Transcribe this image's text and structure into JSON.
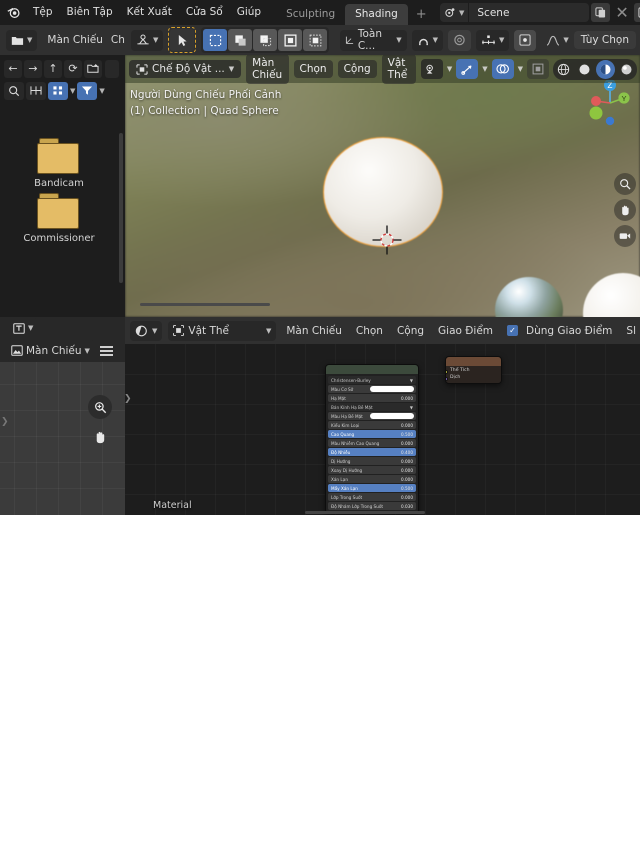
{
  "app": {
    "title": "Blender",
    "logo_icon": "blender-logo-icon"
  },
  "topbar": {
    "menus": [
      "Tệp",
      "Biên Tập",
      "Kết Xuất",
      "Cửa Sổ",
      "Giúp"
    ],
    "workspace_tabs": [
      {
        "label": "Sculpting",
        "active": false
      },
      {
        "label": "Shading",
        "active": true
      },
      {
        "label": "+",
        "active": false
      }
    ],
    "scene": {
      "icon": "scene-icon",
      "value": "Scene",
      "dup_icon": "duplicate-icon",
      "close_icon": "close-icon",
      "viewlayer_icon": "view-layer-icon"
    }
  },
  "toolheader": {
    "editor_type_icon": "file-browser-icon",
    "menus": [
      "Màn Chiếu",
      "Chọn"
    ],
    "transform_orientation": {
      "icon": "orientation-icon",
      "label": "Toàn C..."
    },
    "snap_icon": "snap-magnet-icon",
    "proportional_icon": "proportional-edit-icon",
    "proportional_falloff_icon": "falloff-icon",
    "curve_icon": "curve-icon",
    "cursor_tool_icon": "cursor-tool-icon",
    "select_tool_icon": "tweak-select-icon",
    "select_modes": [
      "select-box-icon",
      "select-extend-icon",
      "select-subtract-icon",
      "select-invert-icon",
      "select-intersect-icon"
    ],
    "options_label": "Tùy Chọn"
  },
  "filebrowser": {
    "editor_icon": "file-browser-icon",
    "header_menus": [
      "Màn Chiếu",
      "Ch"
    ],
    "nav": [
      "back-arrow-icon",
      "forward-arrow-icon",
      "parent-up-icon",
      "refresh-icon",
      "new-folder-icon"
    ],
    "filters": [
      "search-icon",
      "display-mode-icon",
      "sort-icon",
      "filter-icon"
    ],
    "files": [
      {
        "name": "Bandicam",
        "icon": "folder-icon"
      },
      {
        "name": "Commissioner",
        "icon": "folder-icon"
      }
    ]
  },
  "leftpanel": {
    "editor_type_icon": "text-editor-icon",
    "image_editor_icon": "image-editor-icon",
    "mode_label": "Màn Chiếu",
    "menu_icon": "hamburger-menu-icon",
    "zoom_icon": "zoom-in-icon",
    "pan_icon": "hand-pan-icon"
  },
  "viewport": {
    "mode_selector": {
      "icon": "object-mode-icon",
      "label": "Chế Độ Vật ..."
    },
    "menus": [
      "Màn Chiếu",
      "Chọn",
      "Cộng",
      "Vật Thể"
    ],
    "visibility_icon": "visibility-icon",
    "gizmo_icon": "gizmo-icon",
    "overlays_icon": "overlays-icon",
    "xray_icon": "xray-icon",
    "shading_modes": [
      "wireframe-icon",
      "solid-icon",
      "material-preview-icon",
      "rendered-icon"
    ],
    "shading_active_index": 2,
    "overlay_text_line1": "Người Dùng Chiếu Phối Cảnh",
    "overlay_text_line2": "(1) Collection | Quad Sphere",
    "gizmo_axes": [
      "Z",
      "Y",
      "X"
    ],
    "objects": [
      "quad-sphere-selected",
      "chrome-sphere",
      "white-sphere"
    ],
    "cursor_icon": "3d-cursor-icon"
  },
  "shader_editor": {
    "editor_type_icon": "shader-editor-icon",
    "shader_type": {
      "icon": "object-icon",
      "label": "Vật Thể"
    },
    "menus": [
      "Màn Chiếu",
      "Chọn",
      "Cộng",
      "Giao Điểm"
    ],
    "snap_checkbox": {
      "label": "Dùng Giao Điểm",
      "checked": true
    },
    "overflow_label": "Sl",
    "material_label": "Material",
    "sidebar_tab_icon": "sidebar-expand-icon",
    "nodes": [
      {
        "name": "principled-bsdf-node",
        "header_color": "#3c4a3c",
        "distribution": "Christensen-Burley",
        "rows": [
          {
            "label": "Màu Cơ Sở",
            "type": "color",
            "value": "#ffffff",
            "selected": false
          },
          {
            "label": "Hạ Mặt",
            "type": "value",
            "value": "0.000",
            "selected": false
          },
          {
            "label": "Bán Kính Hạ Bề Mặt",
            "type": "dropdown",
            "value": "",
            "selected": false
          },
          {
            "label": "Màu Hạ Bề Mặt",
            "type": "color",
            "value": "#ffffff",
            "selected": false
          },
          {
            "label": "Kiểu Kim Loại",
            "type": "value",
            "value": "0.000",
            "selected": false
          },
          {
            "label": "Cao Quang",
            "type": "value",
            "value": "0.500",
            "selected": true
          },
          {
            "label": "Màu Nhiễm Cao Quang",
            "type": "value",
            "value": "0.000",
            "selected": false
          },
          {
            "label": "Độ Nhiễu",
            "type": "value",
            "value": "0.400",
            "selected": true
          },
          {
            "label": "Dị Hướng",
            "type": "value",
            "value": "0.000",
            "selected": false
          },
          {
            "label": "Xoay Dị Hướng",
            "type": "value",
            "value": "0.000",
            "selected": false
          },
          {
            "label": "Xán Lạn",
            "type": "value",
            "value": "0.000",
            "selected": false
          },
          {
            "label": "Mẩy Xán Lạn",
            "type": "value",
            "value": "0.500",
            "selected": true
          },
          {
            "label": "Lớp Trong Suốt",
            "type": "value",
            "value": "0.000",
            "selected": false
          },
          {
            "label": "Độ Nhám Lớp Trong Suốt",
            "type": "value",
            "value": "0.030",
            "selected": false
          }
        ]
      },
      {
        "name": "material-output-node",
        "header_color": "#6b4a36",
        "rows": [
          {
            "label": "Thể Tích"
          },
          {
            "label": "Dịch"
          }
        ]
      }
    ]
  },
  "colors": {
    "accent_blue": "#4772b3",
    "active_orange": "#f0a03a",
    "panel_bg": "#303030",
    "editor_bg": "#1d1d1d",
    "node_green": "#3c4a3c",
    "node_brown": "#6b4a36",
    "folder_yellow": "#e4bc66"
  }
}
